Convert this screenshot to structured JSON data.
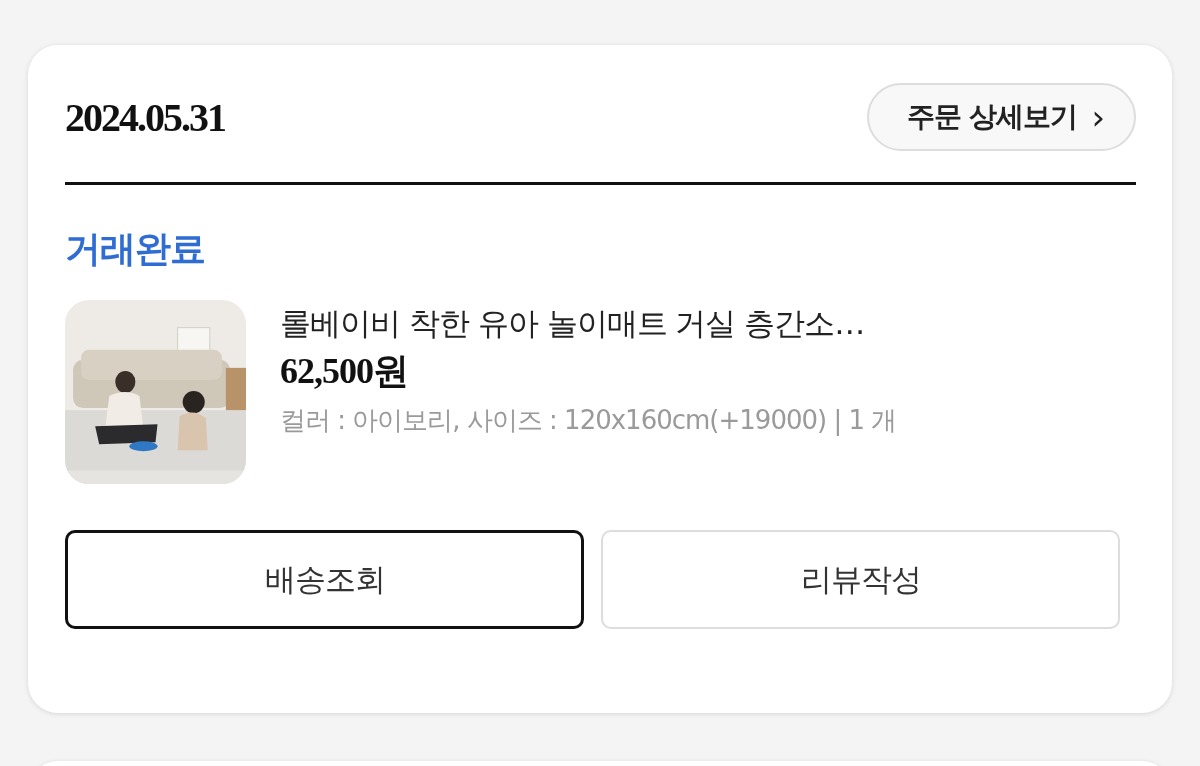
{
  "order": {
    "date": "2024.05.31",
    "detail_link": {
      "label": "주문 상세보기",
      "icon": "›"
    },
    "status": "거래완료",
    "item": {
      "kind": "picture",
      "title": "롤베이비 착한 유아 놀이매트 거실 층간소…",
      "price": "62,500원",
      "options": "컬러 : 아이보리, 사이즈 : 120x160cm(+19000) | 1 개"
    },
    "actions": [
      {
        "label": "배송조회",
        "kind": "primary"
      },
      {
        "label": "리뷰작성",
        "kind": "default"
      }
    ]
  }
}
